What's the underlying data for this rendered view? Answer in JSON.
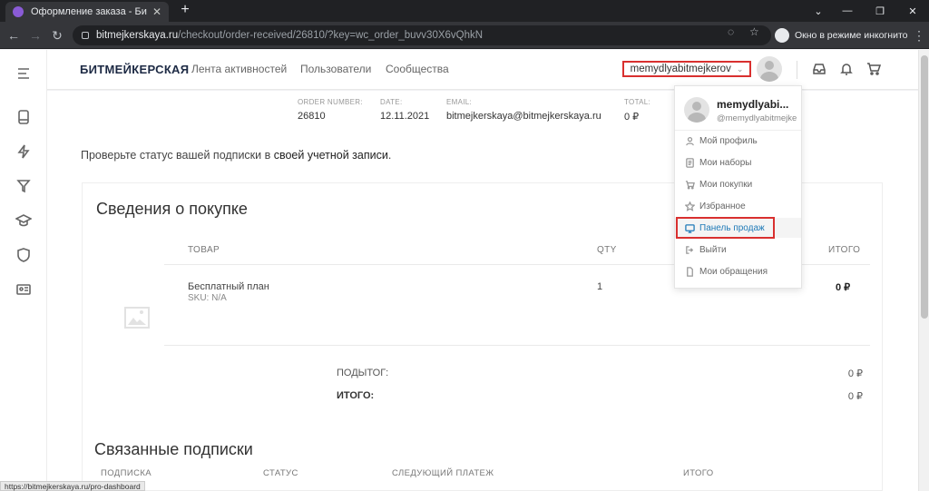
{
  "browser": {
    "tab_title": "Оформление заказа - Битмейке",
    "url_host": "bitmejkerskaya.ru",
    "url_path": "/checkout/order-received/26810/?key=wc_order_buvv30X6vQhkN",
    "incognito_label": "Окно в режиме инкогнито",
    "status_url": "https://bitmejkerskaya.ru/pro-dashboard"
  },
  "header": {
    "logo": "БИТМЕЙКЕРСКАЯ",
    "nav": [
      "Лента активностей",
      "Пользователи",
      "Сообщества"
    ],
    "username": "memydlyabitmejkerov"
  },
  "order_overview": {
    "labels": [
      "ORDER NUMBER:",
      "DATE:",
      "EMAIL:",
      "TOTAL:"
    ],
    "values": [
      "26810",
      "12.11.2021",
      "bitmejkerskaya@bitmejkerskaya.ru",
      "0 ₽"
    ]
  },
  "subscription_note": {
    "text": "Проверьте статус вашей подписки в ",
    "link": "своей учетной записи",
    "end": "."
  },
  "purchase": {
    "title": "Сведения о покупке",
    "columns": [
      "ТОВАР",
      "QTY",
      "ИТОГО"
    ],
    "item": {
      "name": "Бесплатный план",
      "sku": "SKU: N/A",
      "qty": "1",
      "total": "0 ₽"
    },
    "subtotal_label": "ПОДЫТОГ:",
    "subtotal_value": "0 ₽",
    "total_label": "ИТОГО:",
    "total_value": "0 ₽"
  },
  "related": {
    "title": "Связанные подписки",
    "columns": [
      "ПОДПИСКА",
      "СТАТУС",
      "СЛЕДУЮЩИЙ ПЛАТЕЖ",
      "ИТОГО"
    ]
  },
  "dropdown": {
    "name": "memydlyabi...",
    "handle": "@memydlyabitmejkerov",
    "items": [
      {
        "label": "Мой профиль",
        "icon": "user-icon"
      },
      {
        "label": "Мои наборы",
        "icon": "document-icon"
      },
      {
        "label": "Мои покупки",
        "icon": "cart-icon"
      },
      {
        "label": "Избранное",
        "icon": "star-icon"
      },
      {
        "label": "Панель продаж",
        "icon": "monitor-icon"
      },
      {
        "label": "Выйти",
        "icon": "logout-icon"
      },
      {
        "label": "Мои обращения",
        "icon": "file-icon"
      }
    ]
  },
  "colors": {
    "accent": "#1f7ab8",
    "highlight": "#d9302f"
  }
}
